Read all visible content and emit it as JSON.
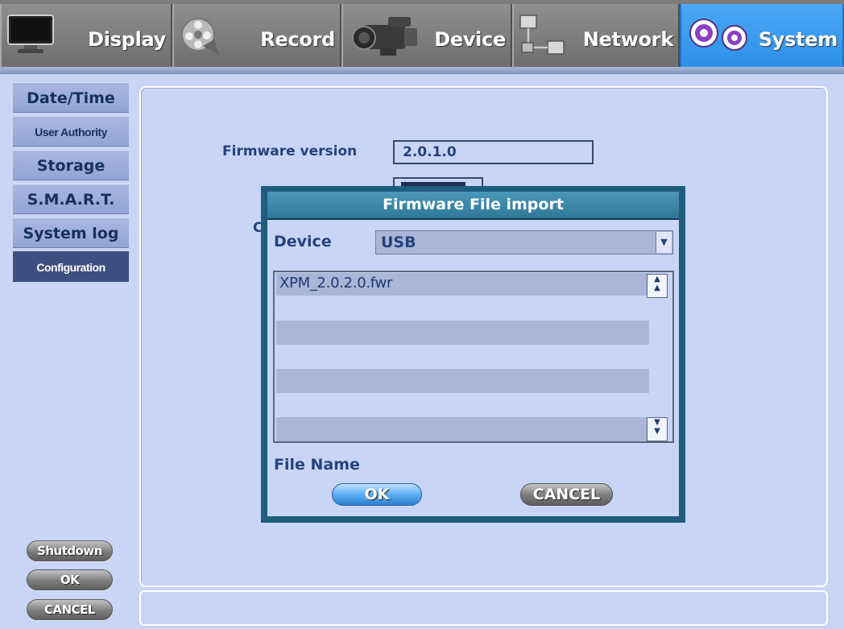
{
  "tabs": [
    {
      "label": "Display",
      "icon": "monitor-icon",
      "active": false
    },
    {
      "label": "Record",
      "icon": "film-reel-icon",
      "active": false
    },
    {
      "label": "Device",
      "icon": "camcorder-icon",
      "active": false
    },
    {
      "label": "Network",
      "icon": "network-icon",
      "active": false
    },
    {
      "label": "System",
      "icon": "gears-icon",
      "active": true
    }
  ],
  "sidebar": {
    "items": [
      {
        "label": "Date/Time"
      },
      {
        "label": "User Authority"
      },
      {
        "label": "Storage"
      },
      {
        "label": "S.M.A.R.T."
      },
      {
        "label": "System log"
      },
      {
        "label": "Configuration",
        "selected": true
      }
    ],
    "shutdown_label": "Shutdown",
    "ok_label": "OK",
    "cancel_label": "CANCEL"
  },
  "main": {
    "firmware_label": "Firmware version",
    "firmware_value": "2.0.1.0",
    "partial_char": "C"
  },
  "modal": {
    "title": "Firmware File import",
    "device_label": "Device",
    "device_value": "USB",
    "files": [
      "XPM_2.0.2.0.fwr",
      "",
      "",
      "",
      "",
      "",
      ""
    ],
    "file_name_label": "File Name",
    "ok_label": "OK",
    "cancel_label": "CANCEL"
  },
  "colors": {
    "active_tab": "#3b9cf0",
    "panel_bg": "#c9d5f6",
    "text": "#26427a",
    "modal_frame": "#1e5d7c"
  }
}
